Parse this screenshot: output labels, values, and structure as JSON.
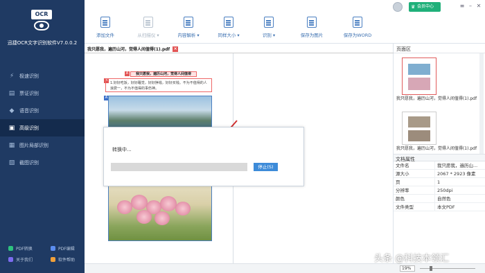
{
  "app": {
    "logo_text": "OCR",
    "title": "迅捷OCR文字识别软件V7.0.0.2"
  },
  "sidebar": {
    "items": [
      {
        "label": "极速识别",
        "icon": "lightning-icon"
      },
      {
        "label": "票证识别",
        "icon": "ticket-icon"
      },
      {
        "label": "语音识别",
        "icon": "voice-icon"
      },
      {
        "label": "高级识别",
        "icon": "advanced-icon",
        "active": true
      },
      {
        "label": "图片局部识别",
        "icon": "crop-icon"
      },
      {
        "label": "截图识别",
        "icon": "screenshot-icon"
      }
    ],
    "bottom": [
      {
        "label": "PDF转换",
        "color": "#2ec27e"
      },
      {
        "label": "PDF编辑",
        "color": "#5b8def"
      },
      {
        "label": "关于我们",
        "color": "#7c6cf0"
      },
      {
        "label": "软件帮助",
        "color": "#f0a03a"
      }
    ]
  },
  "header": {
    "vip_label": "会员中心",
    "toolbar": [
      {
        "label": "添加文件",
        "enabled": true
      },
      {
        "label": "从扫描仪 ▾",
        "enabled": false
      },
      {
        "label": "内容解析 ▾",
        "enabled": true
      },
      {
        "label": "同样大小 ▾",
        "enabled": true
      },
      {
        "label": "识别 ▾",
        "enabled": true
      },
      {
        "label": "保存为图片",
        "enabled": true
      },
      {
        "label": "保存为WORD",
        "enabled": true
      }
    ]
  },
  "document": {
    "tab_label": "我只愿我，遍历山河，觉得人间值得(1).pdf",
    "heading": "我只愿我，遍历山河，觉得人间值得",
    "paragraph": "1.好好吃饭，好好睡觉，好好挣钱，好好买钱。不为不值得的人浪费一，不为不值得的事伤神。"
  },
  "dialog": {
    "title": "转换中...",
    "progress": 0.0,
    "stop_label": "停止(S)"
  },
  "right_panel": {
    "pages_title": "页面区",
    "thumb_caption_1": "我只愿我，遍历山河，觉得人间值得(1).pdf",
    "thumb_caption_2": "我只愿我，遍历山河，觉得人间值得(1).pdf",
    "props_title": "文档属性",
    "props": [
      {
        "k": "文件名",
        "v": "我只愿我，遍历山..."
      },
      {
        "k": "源大小",
        "v": "2067 * 2923 像素"
      },
      {
        "k": "页",
        "v": "1"
      },
      {
        "k": "分辨率",
        "v": "250dpi"
      },
      {
        "k": "颜色",
        "v": "自然色"
      },
      {
        "k": "文件类型",
        "v": "本文PDF"
      }
    ]
  },
  "statusbar": {
    "zoom": "19%"
  },
  "watermark": "头条 @科技本领汇"
}
